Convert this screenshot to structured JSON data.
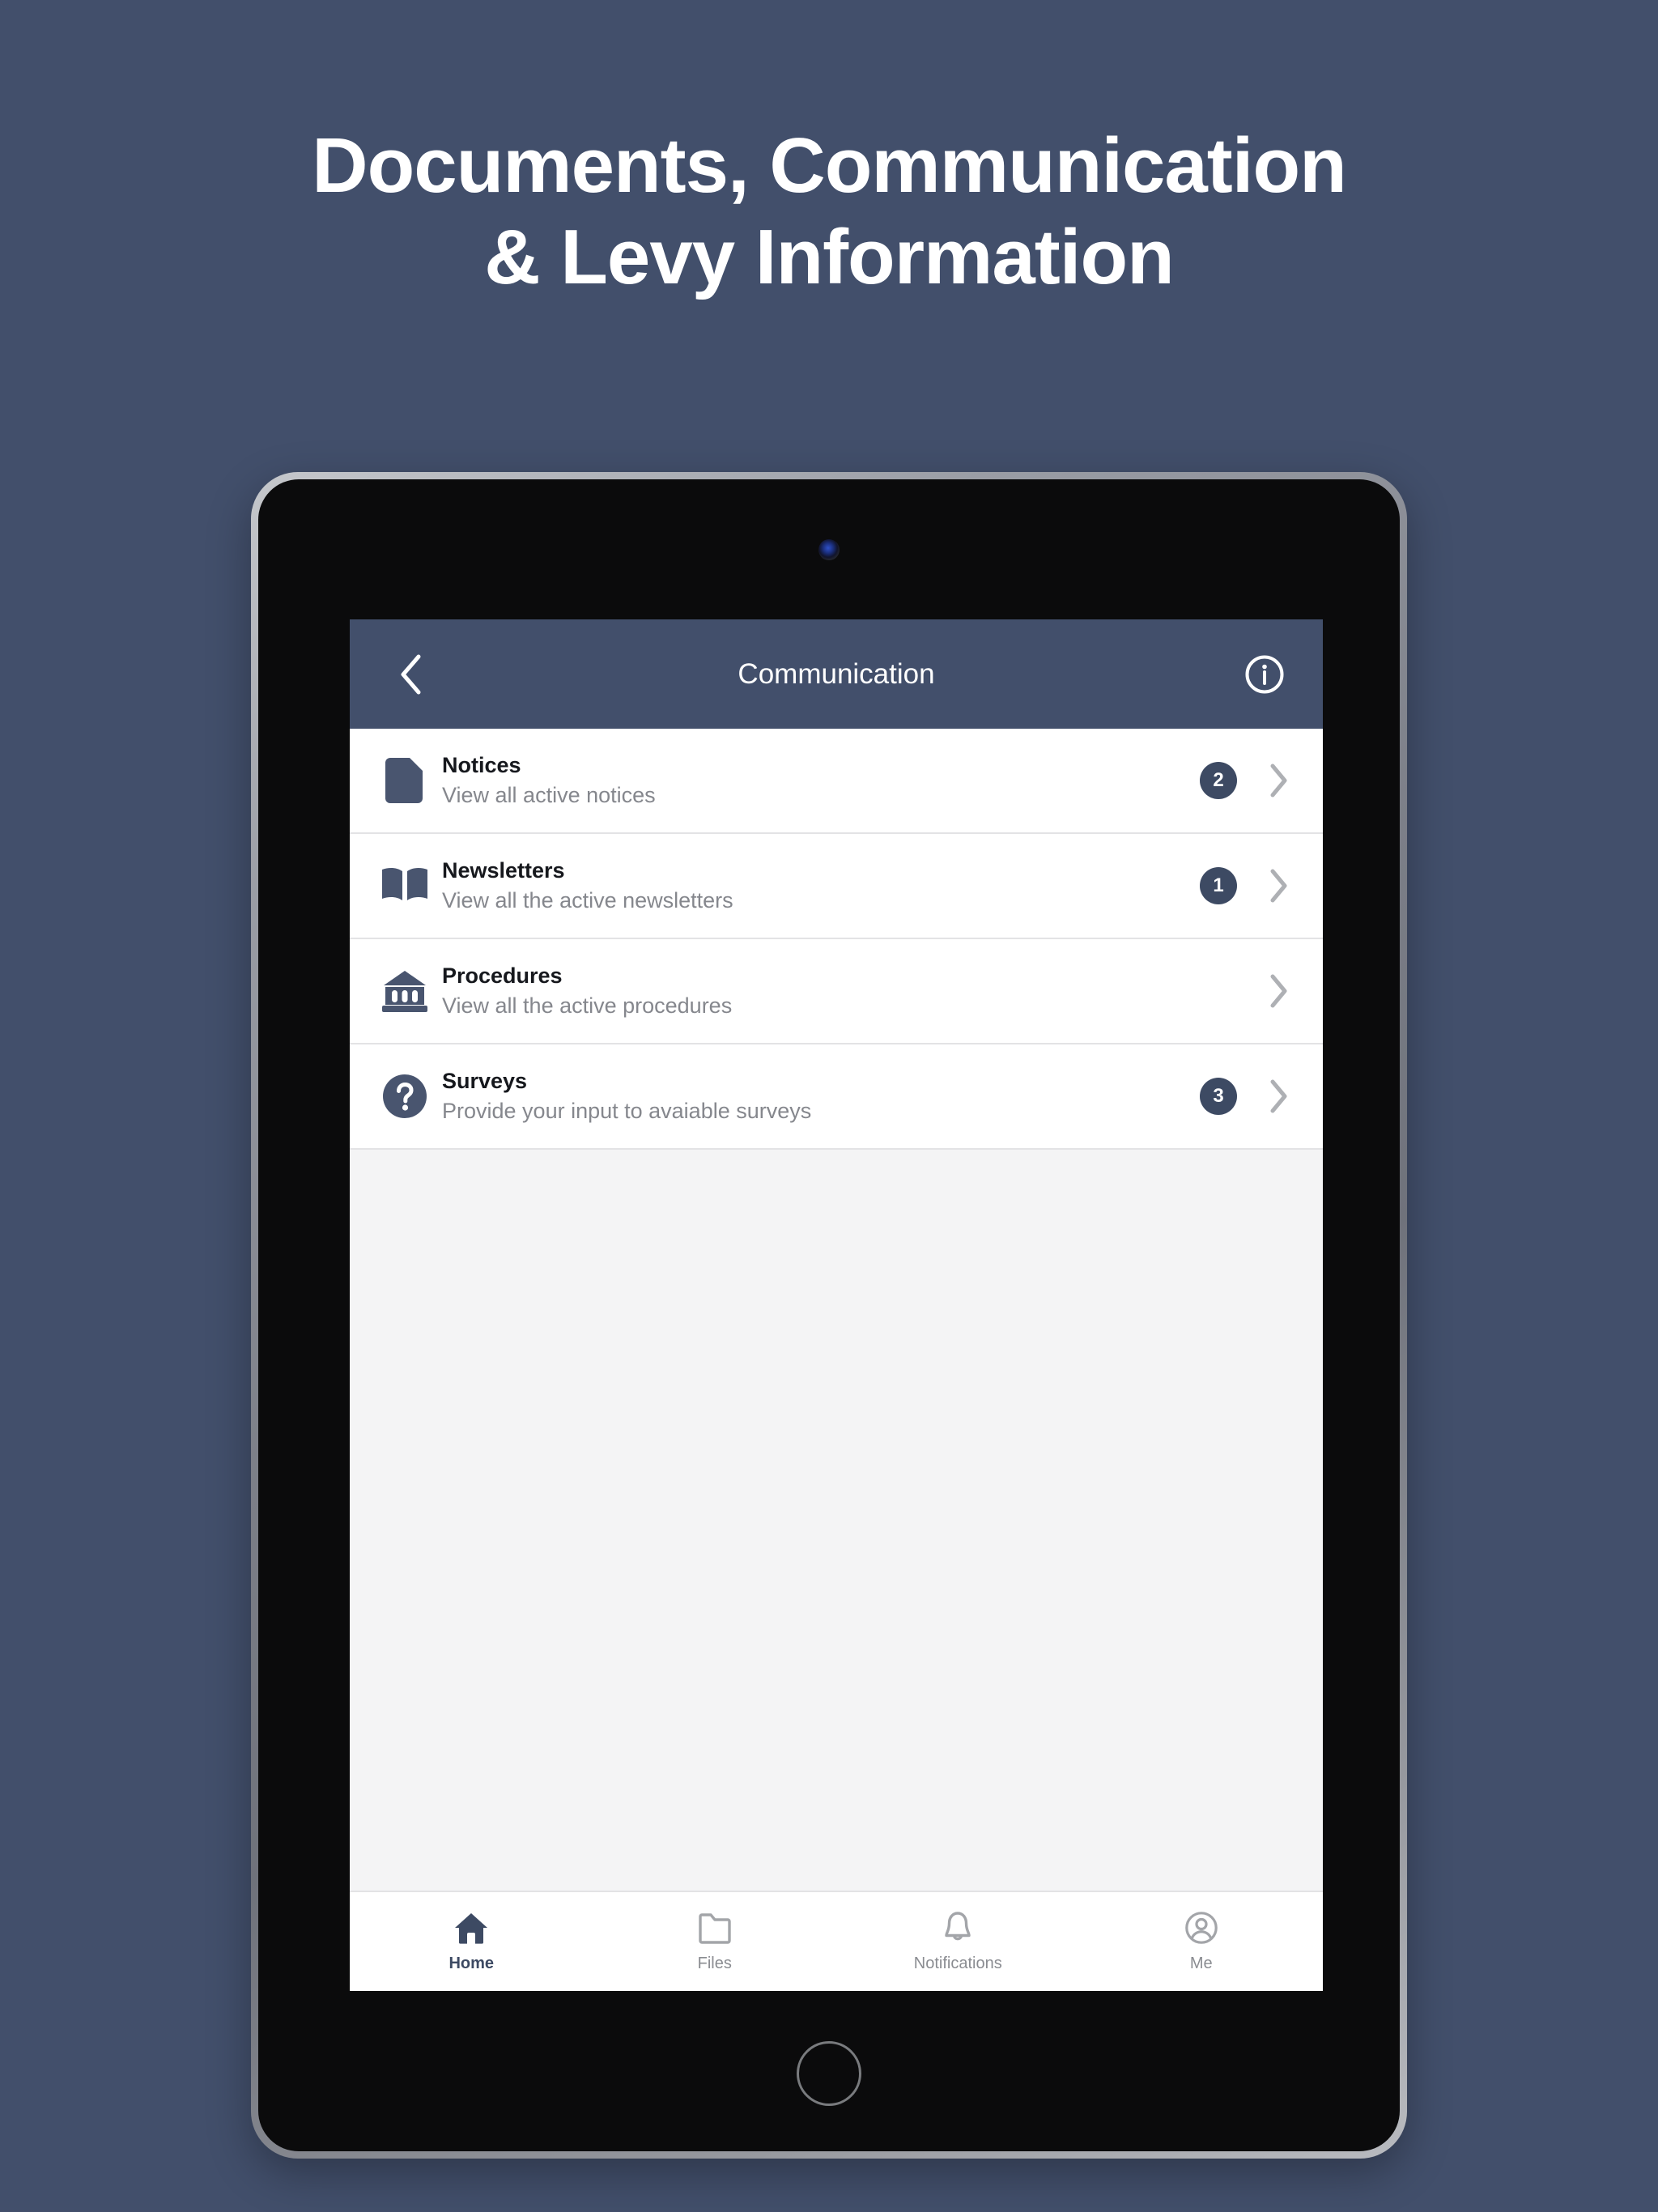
{
  "promo": {
    "headline": "Documents, Communication\n& Levy Information"
  },
  "colors": {
    "page_background": "#424f6b",
    "navbar": "#424f6b",
    "accent_navy": "#3d4a63",
    "badge_text": "#ffffff",
    "row_subtitle": "#85878d",
    "empty_area": "#f4f4f5"
  },
  "app": {
    "navbar": {
      "back_icon": "chevron-left-icon",
      "title": "Communication",
      "info_icon": "info-circle-icon"
    },
    "rows": [
      {
        "icon": "document-icon",
        "title": "Notices",
        "subtitle": "View all active notices",
        "badge": "2",
        "chevron": "chevron-right-icon"
      },
      {
        "icon": "open-book-icon",
        "title": "Newsletters",
        "subtitle": "View all the active newsletters",
        "badge": "1",
        "chevron": "chevron-right-icon"
      },
      {
        "icon": "bank-columns-icon",
        "title": "Procedures",
        "subtitle": "View all the active procedures",
        "badge": "",
        "chevron": "chevron-right-icon"
      },
      {
        "icon": "question-circle-icon",
        "title": "Surveys",
        "subtitle": "Provide your input to avaiable surveys",
        "badge": "3",
        "chevron": "chevron-right-icon"
      }
    ],
    "tabs": [
      {
        "icon": "home-icon",
        "label": "Home",
        "active": true
      },
      {
        "icon": "folder-icon",
        "label": "Files",
        "active": false
      },
      {
        "icon": "bell-icon",
        "label": "Notifications",
        "active": false
      },
      {
        "icon": "person-circle-icon",
        "label": "Me",
        "active": false
      }
    ]
  }
}
